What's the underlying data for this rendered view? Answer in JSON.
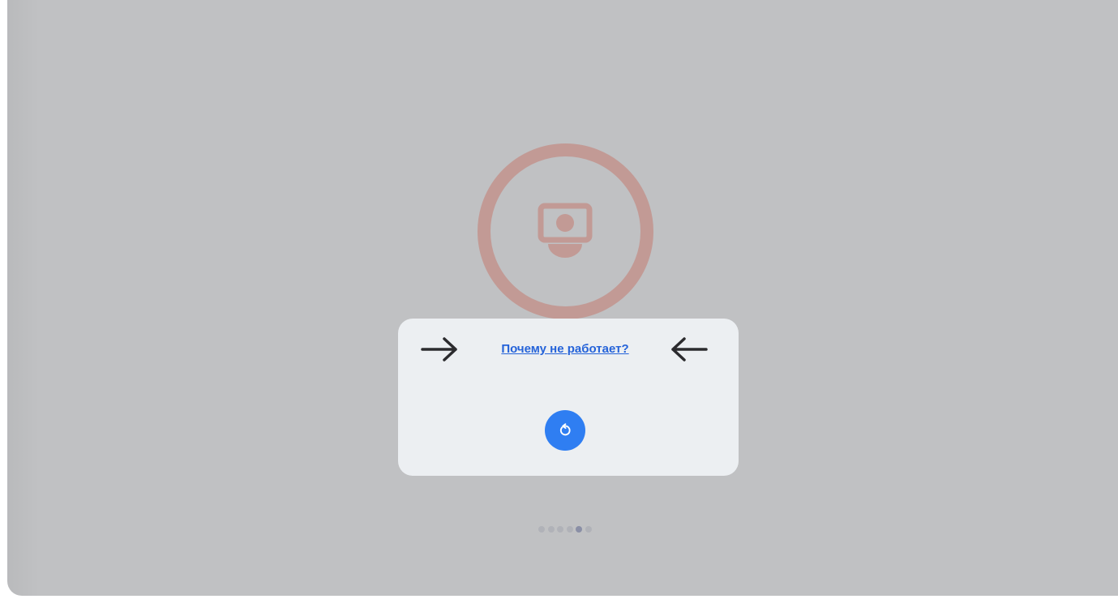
{
  "help_link": {
    "label": "Почему не работает?"
  },
  "icons": {
    "camera": "camera-icon",
    "reload": "reload-icon",
    "arrow_right": "arrow-right-icon",
    "arrow_left": "arrow-left-icon"
  },
  "pagination": {
    "total": 6,
    "active_index": 4
  },
  "colors": {
    "backdrop": "#c0c1c3",
    "ring": "#c29a95",
    "card": "#eceff2",
    "link": "#2563d9",
    "button": "#2f7ef2"
  }
}
